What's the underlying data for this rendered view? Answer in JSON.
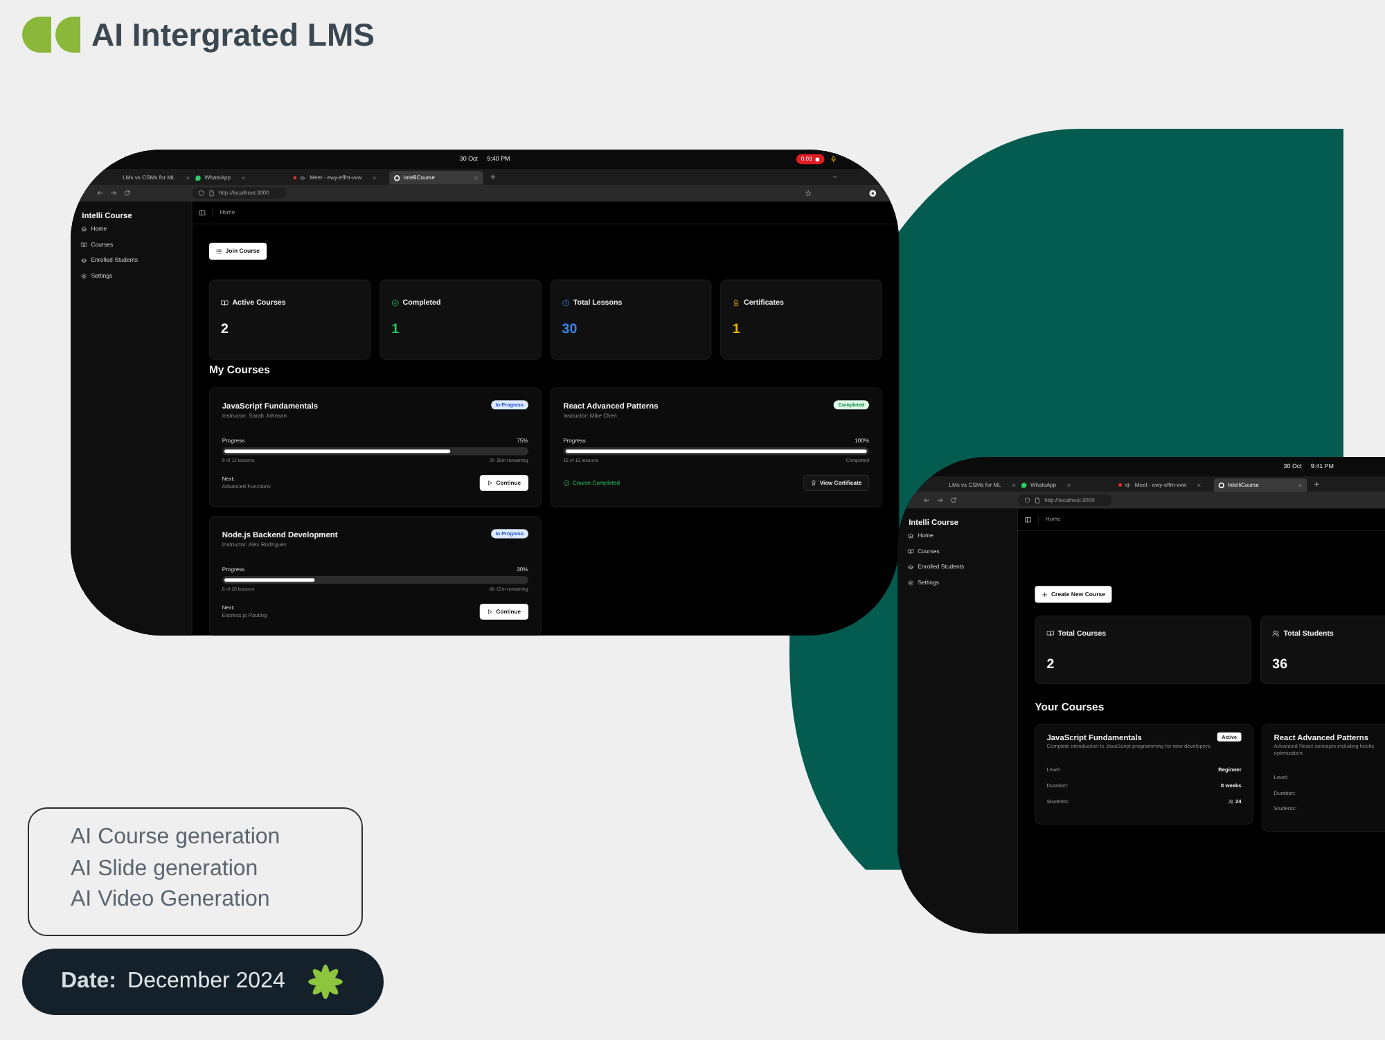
{
  "header": {
    "title": "AI Intergrated LMS"
  },
  "screenshots": [
    {
      "kind": "student",
      "clock": {
        "date": "30 Oct",
        "time": "9:40 PM"
      },
      "recording": "0:03",
      "tabs": [
        {
          "title": "LMs vs CSMs for ML",
          "selected": false
        },
        {
          "title": "WhatsApp",
          "selected": false
        },
        {
          "title": "Meet - ewy-effm-vvw",
          "selected": false
        },
        {
          "title": "IntelliCourse",
          "selected": true
        }
      ],
      "url": "http://localhost:3000",
      "sidebar": {
        "title": "Intelli Course",
        "items": [
          "Home",
          "Courses",
          "Enrolled Students",
          "Settings"
        ]
      },
      "breadcrumb": "Home",
      "action": "Join Course",
      "stats": [
        {
          "label": "Active Courses",
          "value": "2",
          "color": "#ffffff"
        },
        {
          "label": "Completed",
          "value": "1",
          "color": "#22c55e"
        },
        {
          "label": "Total Lessons",
          "value": "30",
          "color": "#3b82f6"
        },
        {
          "label": "Certificates",
          "value": "1",
          "color": "#eab308"
        }
      ],
      "section_title": "My Courses",
      "courses": [
        {
          "kind": "in_progress",
          "title": "JavaScript Fundamentals",
          "instructor": "Instructor: Sarah Johnson",
          "badge": "In Progress",
          "progress_label": "Progress",
          "percent": "75%",
          "level": 0.75,
          "lessons": "9 of 12 lessons",
          "remaining": "2h 30m remaining",
          "next_label": "Next:",
          "next": "Advanced Functions",
          "button": "Continue"
        },
        {
          "kind": "completed",
          "title": "React Advanced Patterns",
          "instructor": "Instructor: Mike Chen",
          "badge": "Completed",
          "progress_label": "Progress",
          "percent": "100%",
          "level": 1,
          "lessons": "15 of 15 lessons",
          "remaining": "Completed",
          "status": "Course Completed",
          "button": "View Certificate"
        },
        {
          "kind": "in_progress",
          "title": "Node.js Backend Development",
          "instructor": "Instructor: Alex Rodriguez",
          "badge": "In Progress",
          "progress_label": "Progress",
          "percent": "30%",
          "level": 0.3,
          "lessons": "6 of 20 lessons",
          "remaining": "8h 15m remaining",
          "next_label": "Next:",
          "next": "Express.js Routing",
          "button": "Continue"
        }
      ]
    },
    {
      "kind": "instructor",
      "clock": {
        "date": "30 Oct",
        "time": "9:41 PM"
      },
      "tabs": [
        {
          "title": "LMs vs CSMs for ML",
          "selected": false
        },
        {
          "title": "WhatsApp",
          "selected": false
        },
        {
          "title": "Meet - ewy-effm-vvw",
          "selected": false
        },
        {
          "title": "IntelliCourse",
          "selected": true
        }
      ],
      "url": "http://localhost:3000",
      "sidebar": {
        "title": "Intelli Course",
        "items": [
          "Home",
          "Courses",
          "Enrolled Students",
          "Settings"
        ]
      },
      "breadcrumb": "Home",
      "action": "Create New Course",
      "stats": [
        {
          "label": "Total Courses",
          "value": "2"
        },
        {
          "label": "Total Students",
          "value": "36"
        }
      ],
      "section_title": "Your Courses",
      "courses": [
        {
          "title": "JavaScript Fundamentals",
          "badge": "Active",
          "description_lines": [
            "Complete introduction to JavaScript programming for new developers."
          ],
          "details": [
            {
              "kind": "text",
              "label": "Level:",
              "value": "Beginner"
            },
            {
              "kind": "text",
              "label": "Duration:",
              "value": "8 weeks"
            },
            {
              "kind": "count",
              "label": "Students:",
              "value": "24"
            }
          ]
        },
        {
          "title": "React Advanced Patterns",
          "description_lines": [
            "Advanced React concepts including hooks",
            "optimization."
          ],
          "details": [
            {
              "label": "Level:"
            },
            {
              "label": "Duration:"
            },
            {
              "label": "Students:"
            }
          ]
        }
      ]
    }
  ],
  "features": [
    "AI Course generation",
    "AI Slide generation",
    "AI Video Generation"
  ],
  "date": {
    "label": "Date:",
    "value": "December 2024"
  }
}
